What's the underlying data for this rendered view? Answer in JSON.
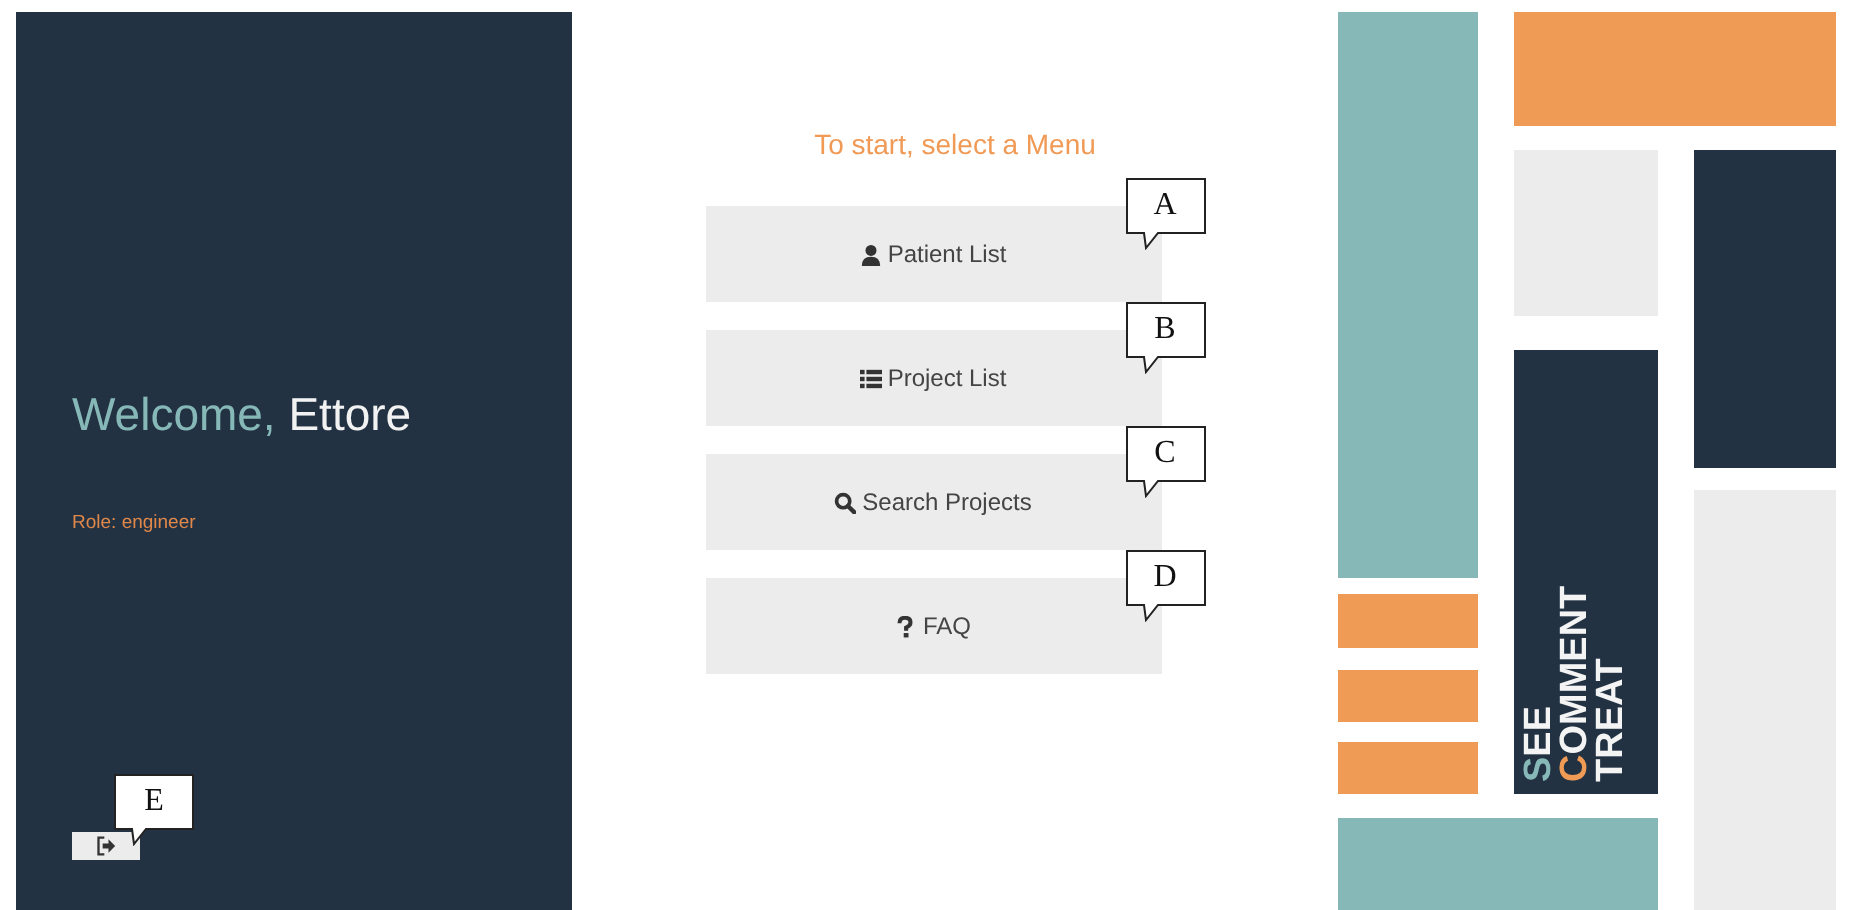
{
  "sidebar": {
    "greeting": "Welcome,",
    "user_name": "Ettore",
    "role": "Role: engineer",
    "logout": {
      "callout": "E"
    }
  },
  "menu": {
    "title": "To start, select a Menu",
    "items": [
      {
        "label": "Patient List",
        "callout": "A"
      },
      {
        "label": "Project List",
        "callout": "B"
      },
      {
        "label": "Search Projects",
        "callout": "C"
      },
      {
        "label": "FAQ",
        "callout": "D"
      }
    ]
  },
  "logo": {
    "lines": [
      {
        "initial": "S",
        "rest": "EE",
        "color": "#86b8b8"
      },
      {
        "initial": "C",
        "rest": "OMMENT",
        "color": "#ef9a55"
      },
      {
        "rest": "TREAT"
      }
    ]
  }
}
